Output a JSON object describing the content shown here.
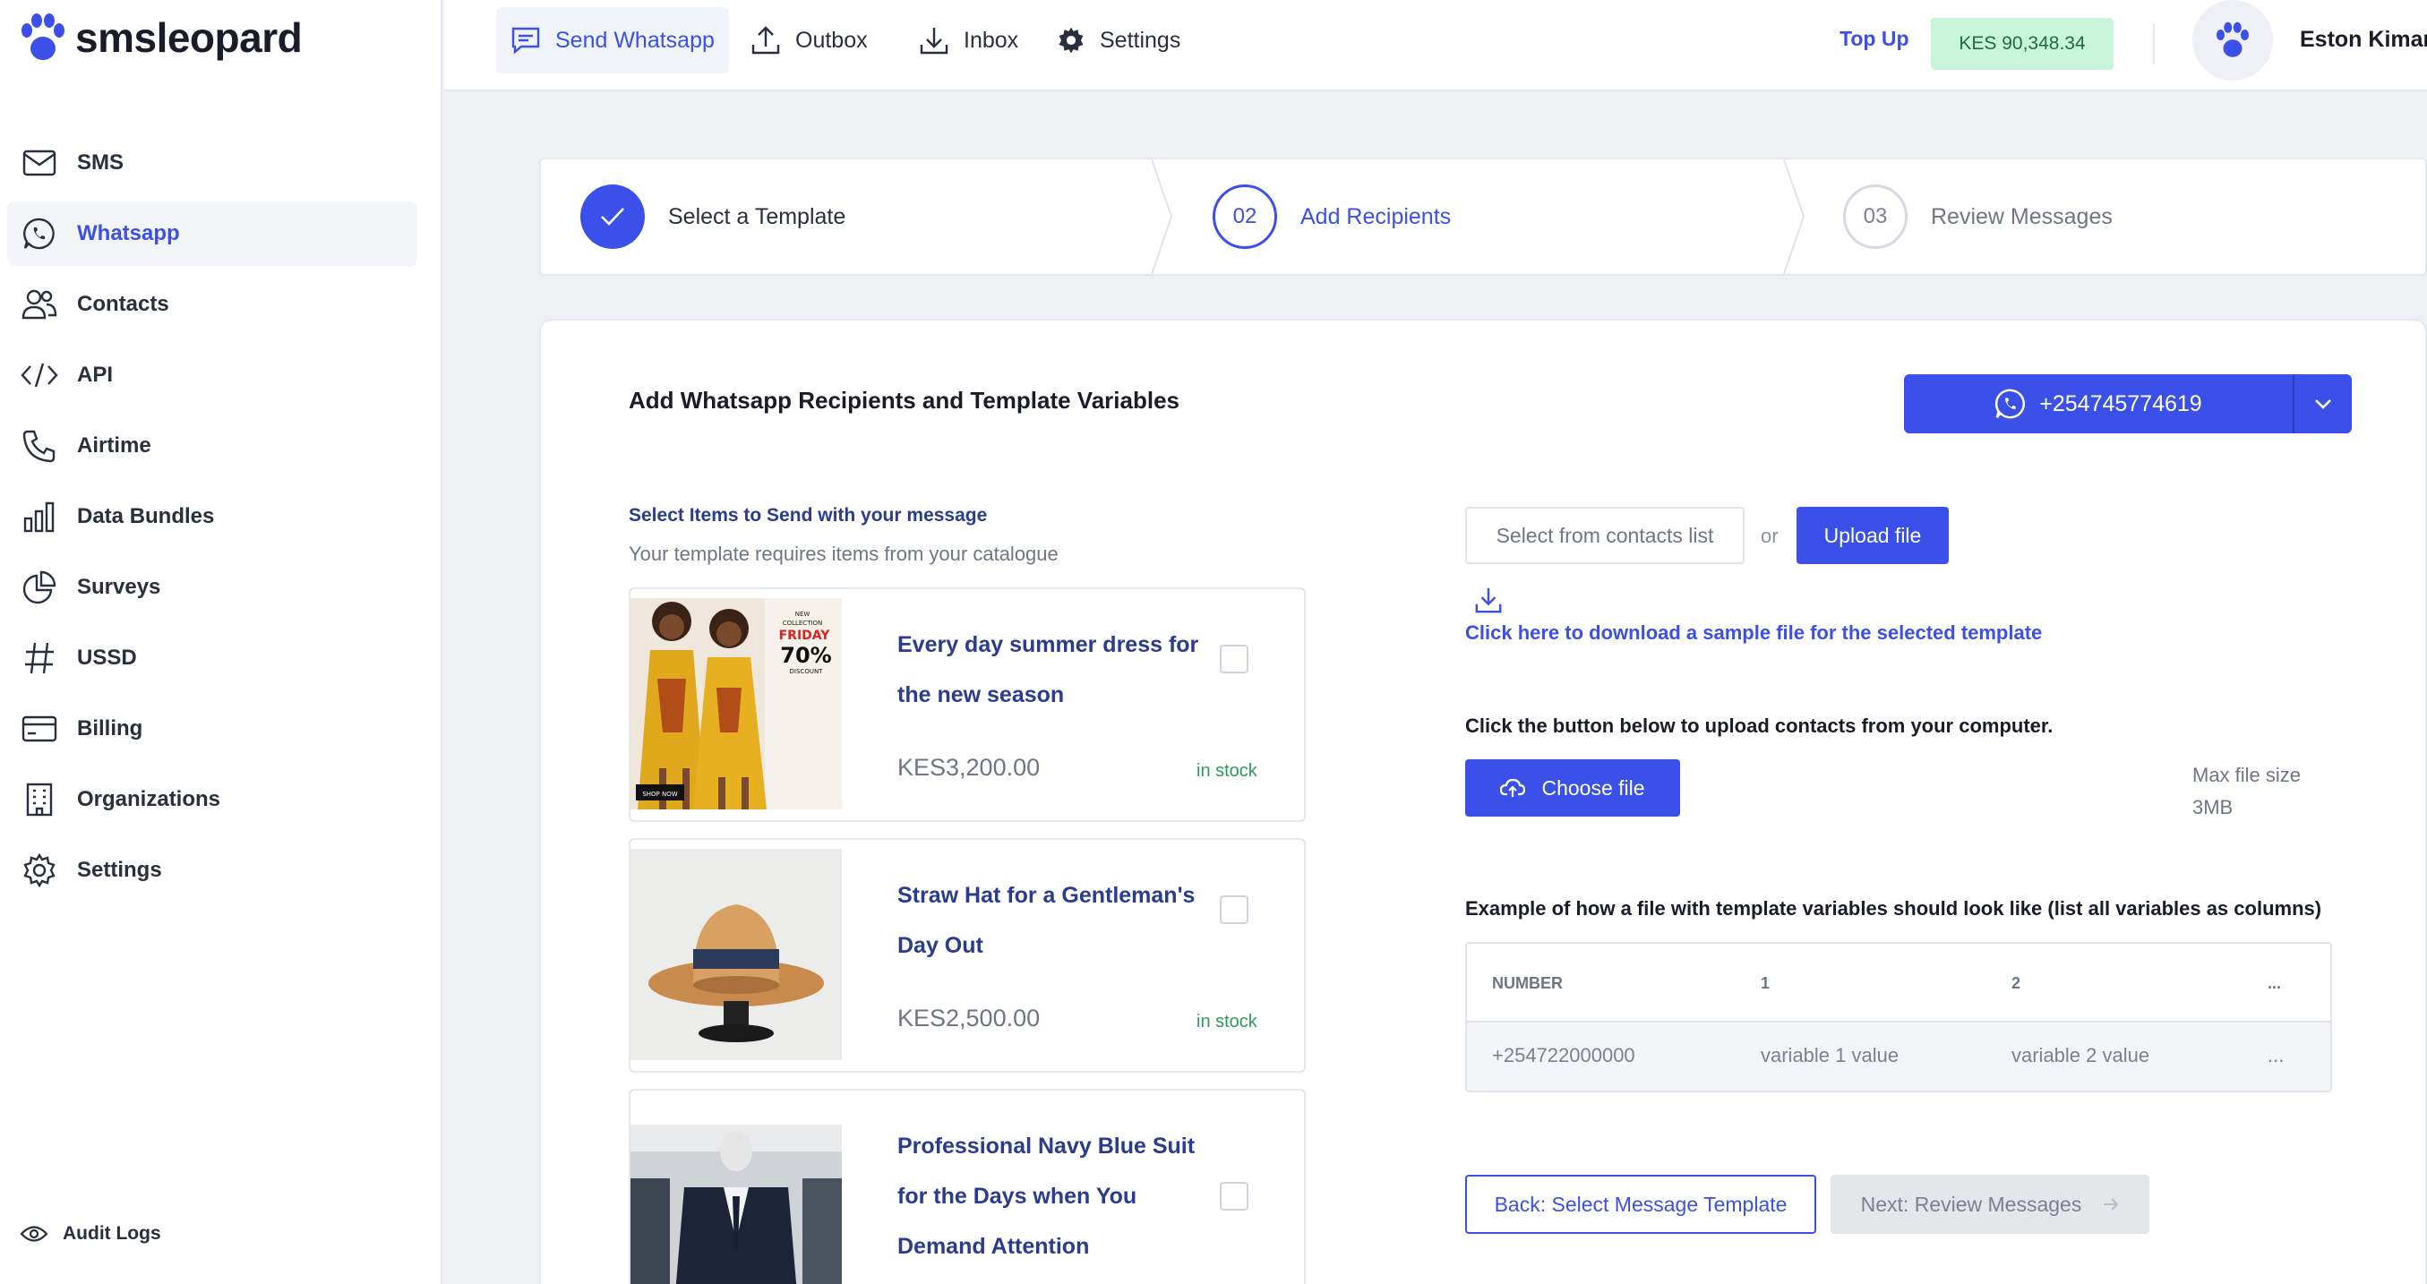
{
  "app": {
    "brand": "smsleopard"
  },
  "sidebar": {
    "items": [
      {
        "label": "SMS",
        "icon": "mail-icon"
      },
      {
        "label": "Whatsapp",
        "icon": "whatsapp-icon",
        "active": true
      },
      {
        "label": "Contacts",
        "icon": "users-icon"
      },
      {
        "label": "API",
        "icon": "code-icon"
      },
      {
        "label": "Airtime",
        "icon": "phone-icon"
      },
      {
        "label": "Data Bundles",
        "icon": "bar-chart-icon"
      },
      {
        "label": "Surveys",
        "icon": "pie-chart-icon"
      },
      {
        "label": "USSD",
        "icon": "hash-icon"
      },
      {
        "label": "Billing",
        "icon": "credit-card-icon"
      },
      {
        "label": "Organizations",
        "icon": "building-icon"
      },
      {
        "label": "Settings",
        "icon": "gear-icon"
      }
    ],
    "audit_logs": "Audit Logs"
  },
  "topbar": {
    "tabs": [
      {
        "label": "Send Whatsapp",
        "icon": "message-icon",
        "active": true
      },
      {
        "label": "Outbox",
        "icon": "upload-icon"
      },
      {
        "label": "Inbox",
        "icon": "download-icon"
      },
      {
        "label": "Settings",
        "icon": "gear-icon"
      }
    ],
    "topup": "Top Up",
    "balance": "KES 90,348.34",
    "user_name": "Eston Kiman"
  },
  "stepper": {
    "steps": [
      {
        "number": "",
        "label": "Select a Template",
        "state": "done"
      },
      {
        "number": "02",
        "label": "Add Recipients",
        "state": "current"
      },
      {
        "number": "03",
        "label": "Review Messages",
        "state": "todo"
      }
    ]
  },
  "main": {
    "title": "Add Whatsapp Recipients and Template Variables",
    "sender_number": "+254745774619",
    "catalogue": {
      "heading": "Select Items to Send with your message",
      "subheading": "Your template requires items from your catalogue",
      "products": [
        {
          "title": "Every day summer dress for the new season",
          "price": "KES3,200.00",
          "stock": "in stock",
          "image": "dress-image"
        },
        {
          "title": "Straw Hat for a Gentleman's Day Out",
          "price": "KES2,500.00",
          "stock": "in stock",
          "image": "hat-image"
        },
        {
          "title": "Professional Navy Blue Suit for the Days when You Demand Attention",
          "price": "",
          "stock": "",
          "image": "suit-image"
        }
      ]
    },
    "recipients": {
      "select_contacts": "Select from contacts list",
      "or": "or",
      "upload_file": "Upload file",
      "download_sample": "Click here to download a sample file for the selected template",
      "upload_instruction": "Click the button below to upload contacts from your computer.",
      "choose_file": "Choose file",
      "max_size_label": "Max file size",
      "max_size_value": "3MB",
      "example_caption": "Example of how a file with template variables should look like (list all variables as columns)",
      "example_table": {
        "headers": [
          "NUMBER",
          "1",
          "2",
          "..."
        ],
        "row": [
          "+254722000000",
          "variable 1 value",
          "variable 2 value",
          "..."
        ]
      }
    },
    "back_button": "Back: Select Message Template",
    "next_button": "Next: Review Messages"
  },
  "colors": {
    "accent": "#3a50e8",
    "balance_bg": "#c8f5d9",
    "stock_green": "#2e9a5c"
  }
}
